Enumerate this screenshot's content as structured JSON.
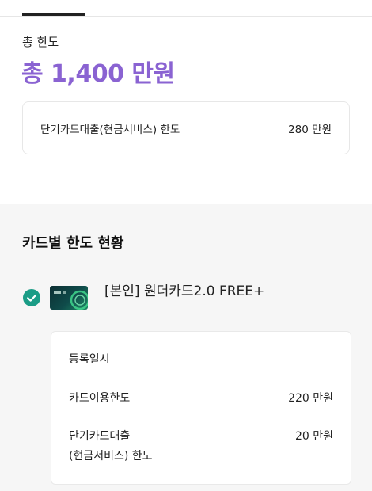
{
  "summary": {
    "total_label": "총 한도",
    "total_amount": "총 1,400 만원",
    "cash_service": {
      "label": "단기카드대출(현금서비스) 한도",
      "value": "280 만원"
    }
  },
  "cards": {
    "section_title": "카드별 한도 현황",
    "card": {
      "name": "[본인] 원더카드2.0 FREE+",
      "selected": true
    },
    "details": {
      "registered_label": "등록일시",
      "usage_label": "카드이용한도",
      "usage_value": "220 만원",
      "cash_label_line1": "단기카드대출",
      "cash_label_line2": "(현금서비스) 한도",
      "cash_value": "20 만원"
    }
  },
  "colors": {
    "accent": "#8a63d2",
    "check": "#1b9c86",
    "background_section": "#f6f6f6"
  },
  "icons": {
    "selected": "check-circle-icon",
    "card_image": "card-thumbnail"
  }
}
